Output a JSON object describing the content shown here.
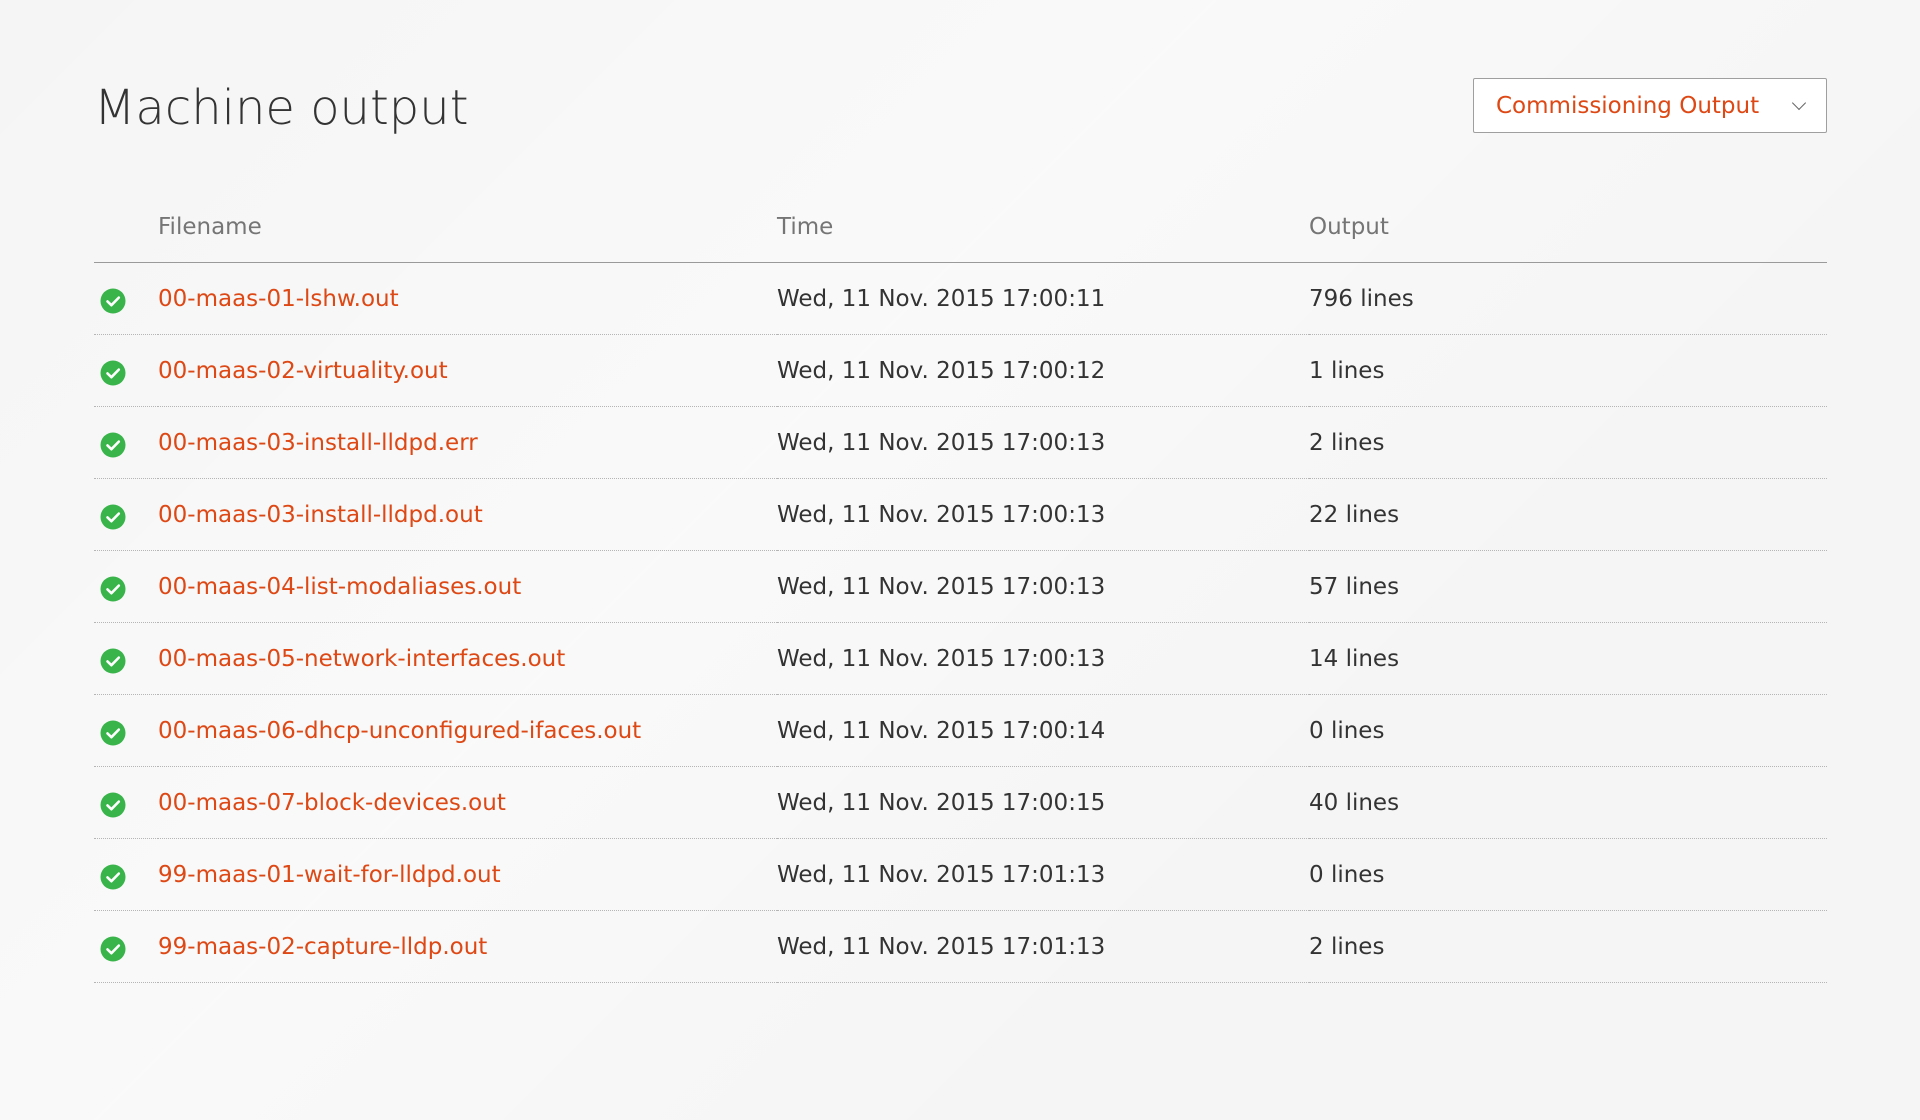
{
  "page": {
    "title": "Machine output"
  },
  "output_select": {
    "value": "Commissioning Output"
  },
  "table": {
    "columns": {
      "filename": "Filename",
      "time": "Time",
      "output": "Output"
    },
    "rows": [
      {
        "status": "success",
        "filename": "00-maas-01-lshw.out",
        "time": "Wed, 11 Nov. 2015 17:00:11",
        "output": "796 lines"
      },
      {
        "status": "success",
        "filename": "00-maas-02-virtuality.out",
        "time": "Wed, 11 Nov. 2015 17:00:12",
        "output": "1 lines"
      },
      {
        "status": "success",
        "filename": "00-maas-03-install-lldpd.err",
        "time": "Wed, 11 Nov. 2015 17:00:13",
        "output": "2 lines"
      },
      {
        "status": "success",
        "filename": "00-maas-03-install-lldpd.out",
        "time": "Wed, 11 Nov. 2015 17:00:13",
        "output": "22 lines"
      },
      {
        "status": "success",
        "filename": "00-maas-04-list-modaliases.out",
        "time": "Wed, 11 Nov. 2015 17:00:13",
        "output": "57 lines"
      },
      {
        "status": "success",
        "filename": "00-maas-05-network-interfaces.out",
        "time": "Wed, 11 Nov. 2015 17:00:13",
        "output": "14 lines"
      },
      {
        "status": "success",
        "filename": "00-maas-06-dhcp-unconfigured-ifaces.out",
        "time": "Wed, 11 Nov. 2015 17:00:14",
        "output": "0 lines"
      },
      {
        "status": "success",
        "filename": "00-maas-07-block-devices.out",
        "time": "Wed, 11 Nov. 2015 17:00:15",
        "output": "40 lines"
      },
      {
        "status": "success",
        "filename": "99-maas-01-wait-for-lldpd.out",
        "time": "Wed, 11 Nov. 2015 17:01:13",
        "output": "0 lines"
      },
      {
        "status": "success",
        "filename": "99-maas-02-capture-lldp.out",
        "time": "Wed, 11 Nov. 2015 17:01:13",
        "output": "2 lines"
      }
    ]
  },
  "icons": {
    "status": "check-circle-icon",
    "select": "chevron-down-icon"
  },
  "colors": {
    "accent": "#dd4814",
    "success": "#38b44a",
    "text": "#333333",
    "muted": "#757575",
    "background": "#f5f5f5"
  }
}
